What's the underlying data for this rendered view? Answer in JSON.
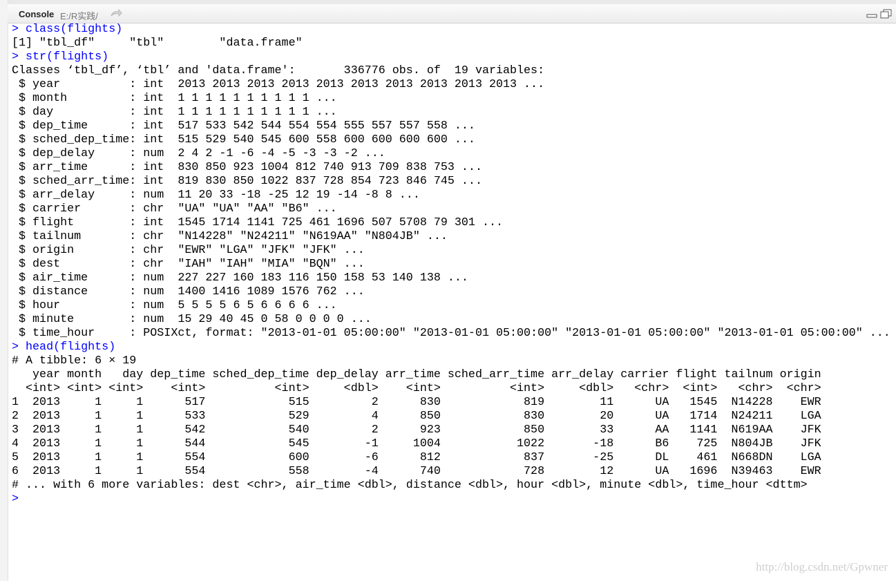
{
  "toolbar": {
    "title": "Console",
    "path": "E:/R实践/"
  },
  "console": {
    "lines": [
      {
        "type": "cmd",
        "text": "> class(flights)"
      },
      {
        "type": "out",
        "text": "[1] \"tbl_df\"     \"tbl\"        \"data.frame\""
      },
      {
        "type": "cmd",
        "text": "> str(flights)"
      },
      {
        "type": "out",
        "text": "Classes ‘tbl_df’, ‘tbl’ and 'data.frame':\t336776 obs. of  19 variables:"
      },
      {
        "type": "out",
        "text": " $ year          : int  2013 2013 2013 2013 2013 2013 2013 2013 2013 2013 ..."
      },
      {
        "type": "out",
        "text": " $ month         : int  1 1 1 1 1 1 1 1 1 1 ..."
      },
      {
        "type": "out",
        "text": " $ day           : int  1 1 1 1 1 1 1 1 1 1 ..."
      },
      {
        "type": "out",
        "text": " $ dep_time      : int  517 533 542 544 554 554 555 557 557 558 ..."
      },
      {
        "type": "out",
        "text": " $ sched_dep_time: int  515 529 540 545 600 558 600 600 600 600 ..."
      },
      {
        "type": "out",
        "text": " $ dep_delay     : num  2 4 2 -1 -6 -4 -5 -3 -3 -2 ..."
      },
      {
        "type": "out",
        "text": " $ arr_time      : int  830 850 923 1004 812 740 913 709 838 753 ..."
      },
      {
        "type": "out",
        "text": " $ sched_arr_time: int  819 830 850 1022 837 728 854 723 846 745 ..."
      },
      {
        "type": "out",
        "text": " $ arr_delay     : num  11 20 33 -18 -25 12 19 -14 -8 8 ..."
      },
      {
        "type": "out",
        "text": " $ carrier       : chr  \"UA\" \"UA\" \"AA\" \"B6\" ..."
      },
      {
        "type": "out",
        "text": " $ flight        : int  1545 1714 1141 725 461 1696 507 5708 79 301 ..."
      },
      {
        "type": "out",
        "text": " $ tailnum       : chr  \"N14228\" \"N24211\" \"N619AA\" \"N804JB\" ..."
      },
      {
        "type": "out",
        "text": " $ origin        : chr  \"EWR\" \"LGA\" \"JFK\" \"JFK\" ..."
      },
      {
        "type": "out",
        "text": " $ dest          : chr  \"IAH\" \"IAH\" \"MIA\" \"BQN\" ..."
      },
      {
        "type": "out",
        "text": " $ air_time      : num  227 227 160 183 116 150 158 53 140 138 ..."
      },
      {
        "type": "out",
        "text": " $ distance      : num  1400 1416 1089 1576 762 ..."
      },
      {
        "type": "out",
        "text": " $ hour          : num  5 5 5 5 6 5 6 6 6 6 ..."
      },
      {
        "type": "out",
        "text": " $ minute        : num  15 29 40 45 0 58 0 0 0 0 ..."
      },
      {
        "type": "out",
        "text": " $ time_hour     : POSIXct, format: \"2013-01-01 05:00:00\" \"2013-01-01 05:00:00\" \"2013-01-01 05:00:00\" \"2013-01-01 05:00:00\" ..."
      },
      {
        "type": "cmd",
        "text": "> head(flights)"
      },
      {
        "type": "out",
        "text": "# A tibble: 6 × 19"
      },
      {
        "type": "out",
        "text": "   year month   day dep_time sched_dep_time dep_delay arr_time sched_arr_time arr_delay carrier flight tailnum origin"
      },
      {
        "type": "out",
        "text": "  <int> <int> <int>    <int>          <int>     <dbl>    <int>          <int>     <dbl>   <chr>  <int>   <chr>  <chr>"
      },
      {
        "type": "out",
        "text": "1  2013     1     1      517            515         2      830            819        11      UA   1545  N14228    EWR"
      },
      {
        "type": "out",
        "text": "2  2013     1     1      533            529         4      850            830        20      UA   1714  N24211    LGA"
      },
      {
        "type": "out",
        "text": "3  2013     1     1      542            540         2      923            850        33      AA   1141  N619AA    JFK"
      },
      {
        "type": "out",
        "text": "4  2013     1     1      544            545        -1     1004           1022       -18      B6    725  N804JB    JFK"
      },
      {
        "type": "out",
        "text": "5  2013     1     1      554            600        -6      812            837       -25      DL    461  N668DN    LGA"
      },
      {
        "type": "out",
        "text": "6  2013     1     1      554            558        -4      740            728        12      UA   1696  N39463    EWR"
      },
      {
        "type": "out",
        "text": "# ... with 6 more variables: dest <chr>, air_time <dbl>, distance <dbl>, hour <dbl>, minute <dbl>, time_hour <dttm>"
      },
      {
        "type": "cmd",
        "text": ">"
      }
    ]
  },
  "watermark": "http://blog.csdn.net/Gpwner",
  "colors": {
    "command": "#0000ff",
    "output": "#000000",
    "toolbar": "#ececec"
  }
}
